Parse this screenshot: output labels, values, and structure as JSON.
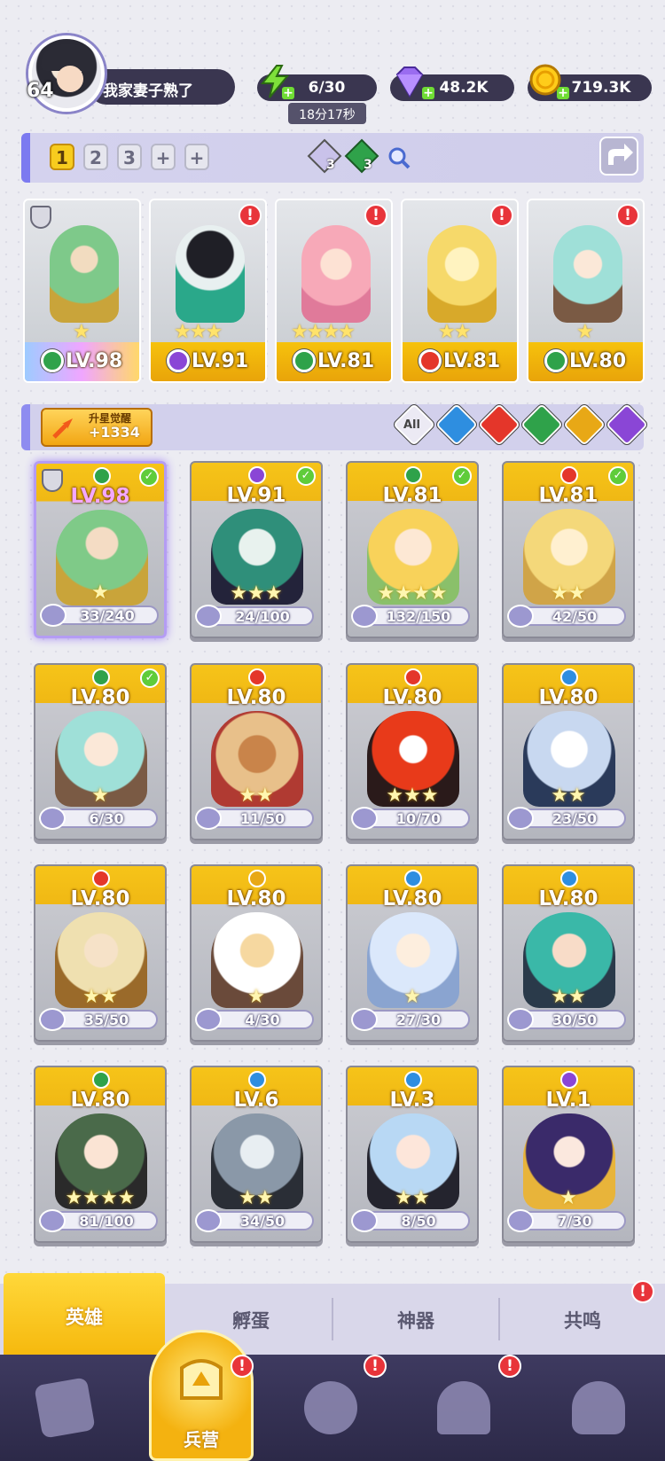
{
  "header": {
    "player_level": "64",
    "player_name": "我家妻子熟了",
    "energy": "6/30",
    "energy_timer": "18分17秒",
    "gems": "48.2K",
    "gold": "719.3K"
  },
  "team_bar": {
    "slots": [
      "1",
      "2",
      "3",
      "+",
      "+"
    ],
    "active_slot": "1",
    "gem_counts": [
      "3",
      "3"
    ]
  },
  "team": [
    {
      "level": "LV.98",
      "element": "nature",
      "stars": "★",
      "alert": "!"
    },
    {
      "level": "LV.91",
      "element": "dark",
      "stars": "★★★",
      "alert": "!"
    },
    {
      "level": "LV.81",
      "element": "nature",
      "stars": "★★★★",
      "alert": "!"
    },
    {
      "level": "LV.81",
      "element": "fire",
      "stars": "★★",
      "alert": "!"
    },
    {
      "level": "LV.80",
      "element": "nature",
      "stars": "★",
      "alert": "!"
    }
  ],
  "filter": {
    "awaken_title": "升星觉醒",
    "awaken_count": "+1334",
    "all_label": "All",
    "elements": [
      "water",
      "fire",
      "nature",
      "light",
      "dark"
    ]
  },
  "heroes": [
    {
      "level": "LV.98",
      "fragments": "33/240",
      "stars": "★",
      "element": "nature",
      "checked": true
    },
    {
      "level": "LV.91",
      "fragments": "24/100",
      "stars": "★★★",
      "element": "dark",
      "checked": true
    },
    {
      "level": "LV.81",
      "fragments": "132/150",
      "stars": "★★★★",
      "element": "nature",
      "checked": true
    },
    {
      "level": "LV.81",
      "fragments": "42/50",
      "stars": "★★",
      "element": "fire",
      "checked": true
    },
    {
      "level": "LV.80",
      "fragments": "6/30",
      "stars": "★",
      "element": "nature",
      "checked": true
    },
    {
      "level": "LV.80",
      "fragments": "11/50",
      "stars": "★★",
      "element": "fire",
      "checked": false
    },
    {
      "level": "LV.80",
      "fragments": "10/70",
      "stars": "★★★",
      "element": "fire",
      "checked": false
    },
    {
      "level": "LV.80",
      "fragments": "23/50",
      "stars": "★★",
      "element": "water",
      "checked": false
    },
    {
      "level": "LV.80",
      "fragments": "35/50",
      "stars": "★★",
      "element": "fire",
      "checked": false
    },
    {
      "level": "LV.80",
      "fragments": "4/30",
      "stars": "★",
      "element": "light",
      "checked": false
    },
    {
      "level": "LV.80",
      "fragments": "27/30",
      "stars": "★",
      "element": "water",
      "checked": false
    },
    {
      "level": "LV.80",
      "fragments": "30/50",
      "stars": "★★",
      "element": "water",
      "checked": false
    },
    {
      "level": "LV.80",
      "fragments": "81/100",
      "stars": "★★★★",
      "element": "nature",
      "checked": false
    },
    {
      "level": "LV.6",
      "fragments": "34/50",
      "stars": "★★",
      "element": "water",
      "checked": false
    },
    {
      "level": "LV.3",
      "fragments": "8/50",
      "stars": "★★",
      "element": "water",
      "checked": false
    },
    {
      "level": "LV.1",
      "fragments": "7/30",
      "stars": "★",
      "element": "dark",
      "checked": false
    }
  ],
  "sub_tabs": [
    "英雄",
    "孵蛋",
    "神器",
    "共鸣"
  ],
  "sub_tab_alert": "!",
  "nav": {
    "active_label": "兵营",
    "alert": "!"
  },
  "colors": {
    "nature": "#2fa24a",
    "dark": "#8a46d6",
    "fire": "#e4362a",
    "water": "#2e8ee0",
    "light": "#e8a816",
    "gold": "#f6c20c"
  }
}
